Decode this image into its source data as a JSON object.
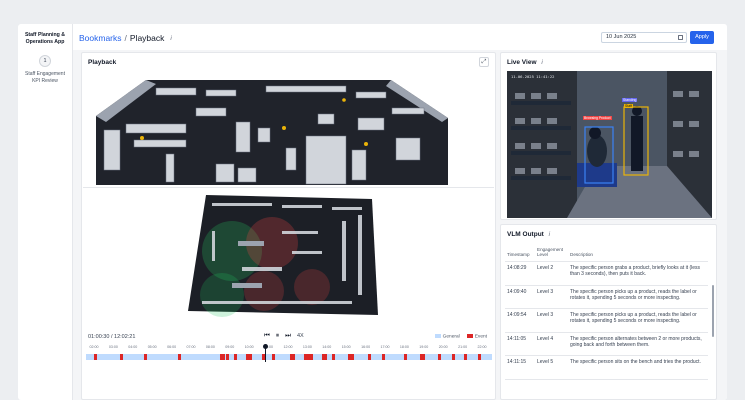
{
  "sidebar": {
    "app_title": "Staff Planning & Operations App",
    "step_number": "1",
    "step_label": "Staff Engagement KPI Review"
  },
  "breadcrumb": {
    "parent": "Bookmarks",
    "separator": "/",
    "current": "Playback"
  },
  "date_filter": {
    "value": "10 Jun 2025",
    "apply_label": "Apply"
  },
  "playback": {
    "title": "Playback",
    "time_current": "01:00:30",
    "time_separator": "/",
    "time_total": "12:02:21",
    "speed": "4X",
    "legend": [
      {
        "label": "General",
        "color": "#bfdbfe"
      },
      {
        "label": "Event",
        "color": "#dc2626"
      }
    ],
    "ticks": [
      "02:00",
      "03:00",
      "04:00",
      "05:00",
      "06:00",
      "07:00",
      "08:00",
      "09:00",
      "10:00",
      "11:00",
      "12:00",
      "13:00",
      "14:00",
      "15:00",
      "16:00",
      "17:00",
      "18:00",
      "19:00",
      "20:00",
      "21:00",
      "22:00"
    ],
    "progress": 0.44
  },
  "live_view": {
    "title": "Live View",
    "timestamp": "11-06-2025 11:41:22",
    "detections": [
      {
        "label": "Standing",
        "color": "#6366f1"
      },
      {
        "label": "Staff",
        "color": "#eab308"
      },
      {
        "label": "Browsing Product",
        "color": "#ef4444"
      }
    ]
  },
  "vlm_output": {
    "title": "VLM Output",
    "columns": [
      "Timestamp",
      "Engagement Level",
      "Description"
    ],
    "rows": [
      {
        "timestamp": "14:08:29",
        "level": "Level 2",
        "description": "The specific person grabs a product, briefly looks at it (less than 3 seconds), then puts it back."
      },
      {
        "timestamp": "14:09:40",
        "level": "Level 3",
        "description": "The specific person picks up a product, reads the label or rotates it, spending 5 seconds or more inspecting."
      },
      {
        "timestamp": "14:09:54",
        "level": "Level 3",
        "description": "The specific person picks up a product, reads the label or rotates it, spending 5 seconds or more inspecting."
      },
      {
        "timestamp": "14:11:05",
        "level": "Level 4",
        "description": "The specific person alternates between 2 or more products, going back and forth between them."
      },
      {
        "timestamp": "14:11:15",
        "level": "Level 5",
        "description": "The specific person sits on the bench and tries the product."
      }
    ]
  }
}
